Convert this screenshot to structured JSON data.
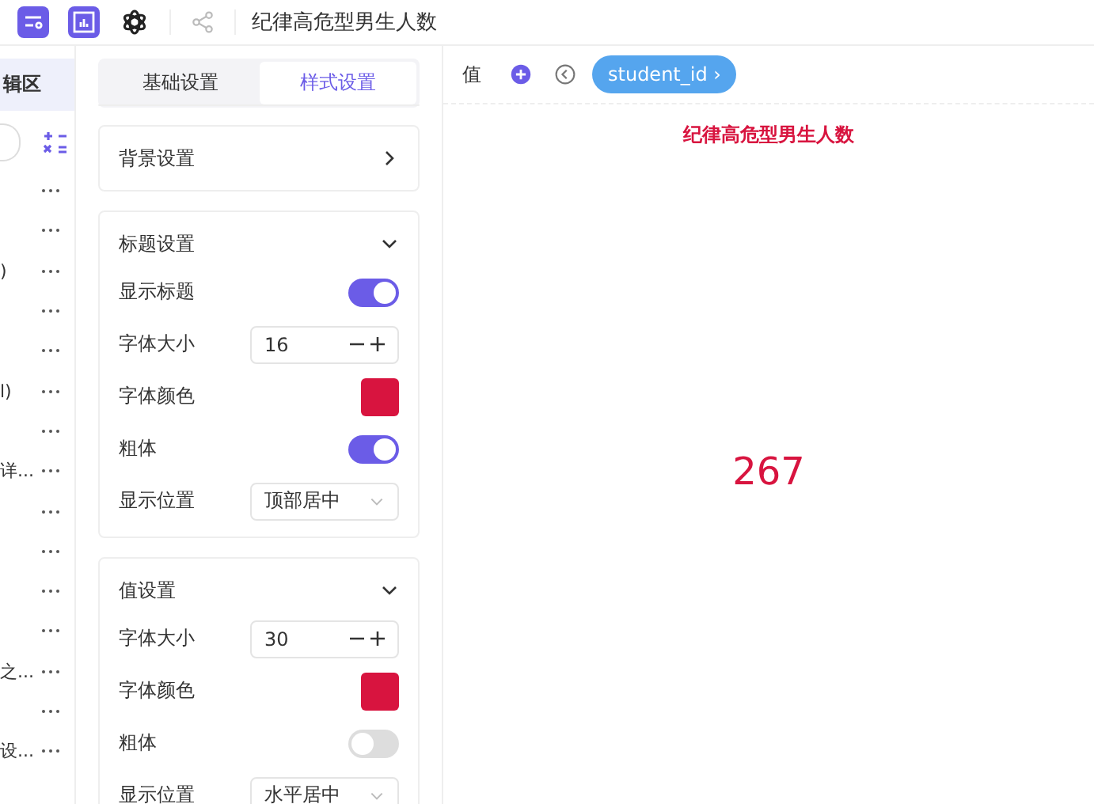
{
  "toolbar": {
    "title": "纪律高危型男生人数"
  },
  "sidebar": {
    "header": "辑区",
    "items": [
      {
        "kind": "field"
      },
      {
        "kind": "field"
      },
      {
        "kind": "field",
        "label": ")"
      },
      {
        "kind": "field"
      },
      {
        "kind": "field"
      },
      {
        "kind": "field",
        "label": "l)"
      },
      {
        "kind": "field"
      },
      {
        "kind": "field",
        "label": "详..."
      },
      {
        "kind": "field"
      },
      {
        "kind": "field"
      },
      {
        "kind": "field"
      },
      {
        "kind": "field"
      },
      {
        "kind": "field",
        "label": "之..."
      },
      {
        "kind": "field"
      },
      {
        "kind": "field",
        "label": "设..."
      }
    ]
  },
  "settings": {
    "tabs": [
      {
        "label": "基础设置",
        "selected": false
      },
      {
        "label": "样式设置",
        "selected": true
      }
    ],
    "sections": [
      {
        "title": "背景设置",
        "expanded": false
      },
      {
        "title": "标题设置",
        "expanded": true,
        "rows": [
          {
            "kind": "toggle",
            "label": "显示标题",
            "on": true
          },
          {
            "kind": "number",
            "label": "字体大小",
            "value": "16"
          },
          {
            "kind": "color",
            "label": "字体颜色",
            "color": "#d8143f"
          },
          {
            "kind": "toggle",
            "label": "粗体",
            "on": true
          },
          {
            "kind": "select",
            "label": "显示位置",
            "value": "顶部居中"
          }
        ]
      },
      {
        "title": "值设置",
        "expanded": true,
        "rows": [
          {
            "kind": "number",
            "label": "字体大小",
            "value": "30"
          },
          {
            "kind": "color",
            "label": "字体颜色",
            "color": "#d8143f"
          },
          {
            "kind": "toggle",
            "label": "粗体",
            "on": false
          },
          {
            "kind": "select",
            "label": "显示位置",
            "value": "水平居中"
          }
        ]
      }
    ]
  },
  "canvas": {
    "field_label": "值",
    "field_chip": "student_id ›",
    "chart_title": "纪律高危型男生人数",
    "value": "267"
  }
}
